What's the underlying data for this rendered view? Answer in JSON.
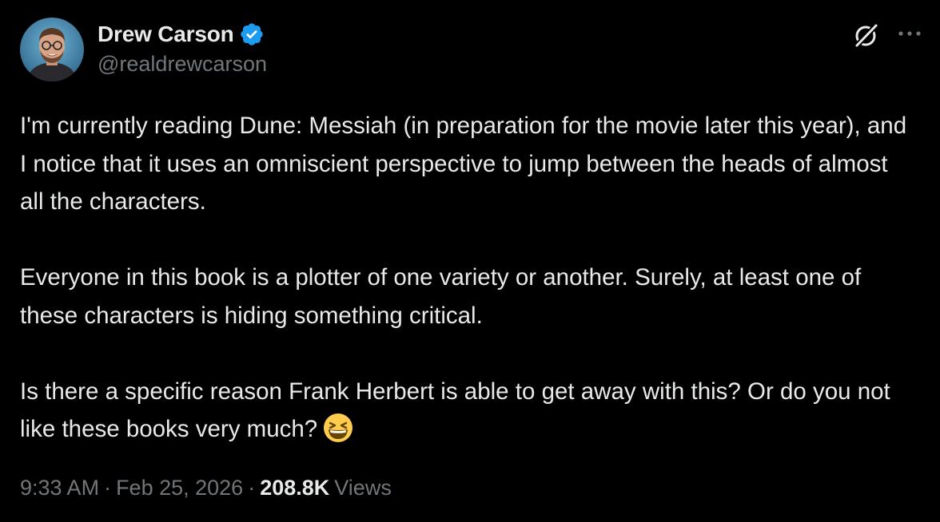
{
  "author": {
    "display_name": "Drew Carson",
    "handle": "@realdrewcarson",
    "verified": true,
    "verified_color": "#1d9bf0"
  },
  "icons": {
    "grok": "grok-icon",
    "more": "more-horizontal-icon",
    "emoji": "grinning-squinting-face-emoji"
  },
  "tweet": {
    "paragraphs": [
      "I'm currently reading Dune: Messiah (in preparation for the movie later this year), and I notice that it uses an omniscient perspective to jump between the heads of almost all the characters.",
      "Everyone in this book is a plotter of one variety or another. Surely, at least one of these characters is hiding something critical.",
      "Is there a specific reason Frank Herbert is able to get away with this? Or do you not like these books very much?"
    ]
  },
  "meta": {
    "time": "9:33 AM",
    "separator": "·",
    "date": "Feb 25, 2026",
    "views_count": "208.8K",
    "views_label": "Views"
  },
  "colors": {
    "background": "#000000",
    "primary_text": "#e7e9ea",
    "secondary_text": "#71767b"
  }
}
